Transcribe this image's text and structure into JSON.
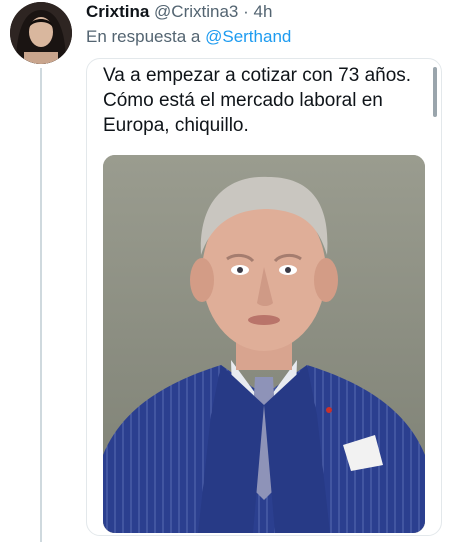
{
  "author": {
    "display_name": "Crixtina",
    "handle": "@Crixtina3",
    "separator": "·",
    "time": "4h"
  },
  "reply": {
    "prefix": "En respuesta a",
    "mention": "@Serthand"
  },
  "tweet": {
    "lines": [
      "Va a empezar a cotizar con 73 años.",
      "Cómo está el mercado laboral en",
      "Europa, chiquillo."
    ]
  },
  "colors": {
    "accent": "#1d9bf0",
    "secondary_text": "#536471",
    "suit": "#2b3f8f"
  }
}
